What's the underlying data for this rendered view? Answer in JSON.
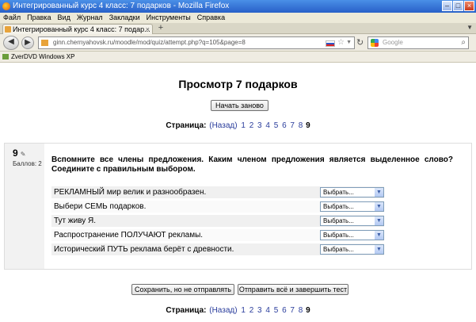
{
  "window": {
    "title": "Интегрированный курс 4 класс: 7 подарков - Mozilla Firefox"
  },
  "menu": [
    "Файл",
    "Правка",
    "Вид",
    "Журнал",
    "Закладки",
    "Инструменты",
    "Справка"
  ],
  "tab": {
    "title": "Интегрированный курс 4 класс: 7 подар..."
  },
  "nav": {
    "url": "ginn.chernyahovsk.ru/moodle/mod/quiz/attempt.php?q=105&page=8",
    "search_placeholder": "Google"
  },
  "bookmarks": {
    "item": "ZverDVD Windows XP"
  },
  "page": {
    "heading": "Просмотр 7 подарков",
    "restart_label": "Начать заново",
    "pager": {
      "label": "Страница:",
      "back": "(Назад)",
      "pages": [
        "1",
        "2",
        "3",
        "4",
        "5",
        "6",
        "7",
        "8"
      ],
      "current": "9"
    },
    "question": {
      "number": "9",
      "grade": "Баллов: 2",
      "text": "Вспомните все члены предложения. Каким членом предложения является выделенное слово? Соедините с правильным выбором.",
      "rows": [
        {
          "label": "РЕКЛАМНЫЙ мир велик и разнообразен.",
          "selected": "Выбрать..."
        },
        {
          "label": "Выбери СЕМЬ подарков.",
          "selected": "Выбрать..."
        },
        {
          "label": "Тут живу Я.",
          "selected": "Выбрать..."
        },
        {
          "label": "Распространение ПОЛУЧАЮТ рекламы.",
          "selected": "Выбрать..."
        },
        {
          "label": "Исторический ПУТЬ реклама берёт с древности.",
          "selected": "Выбрать..."
        }
      ]
    },
    "save_label": "Сохранить, но не отправлять",
    "submit_label": "Отправить всё и завершить тест"
  }
}
